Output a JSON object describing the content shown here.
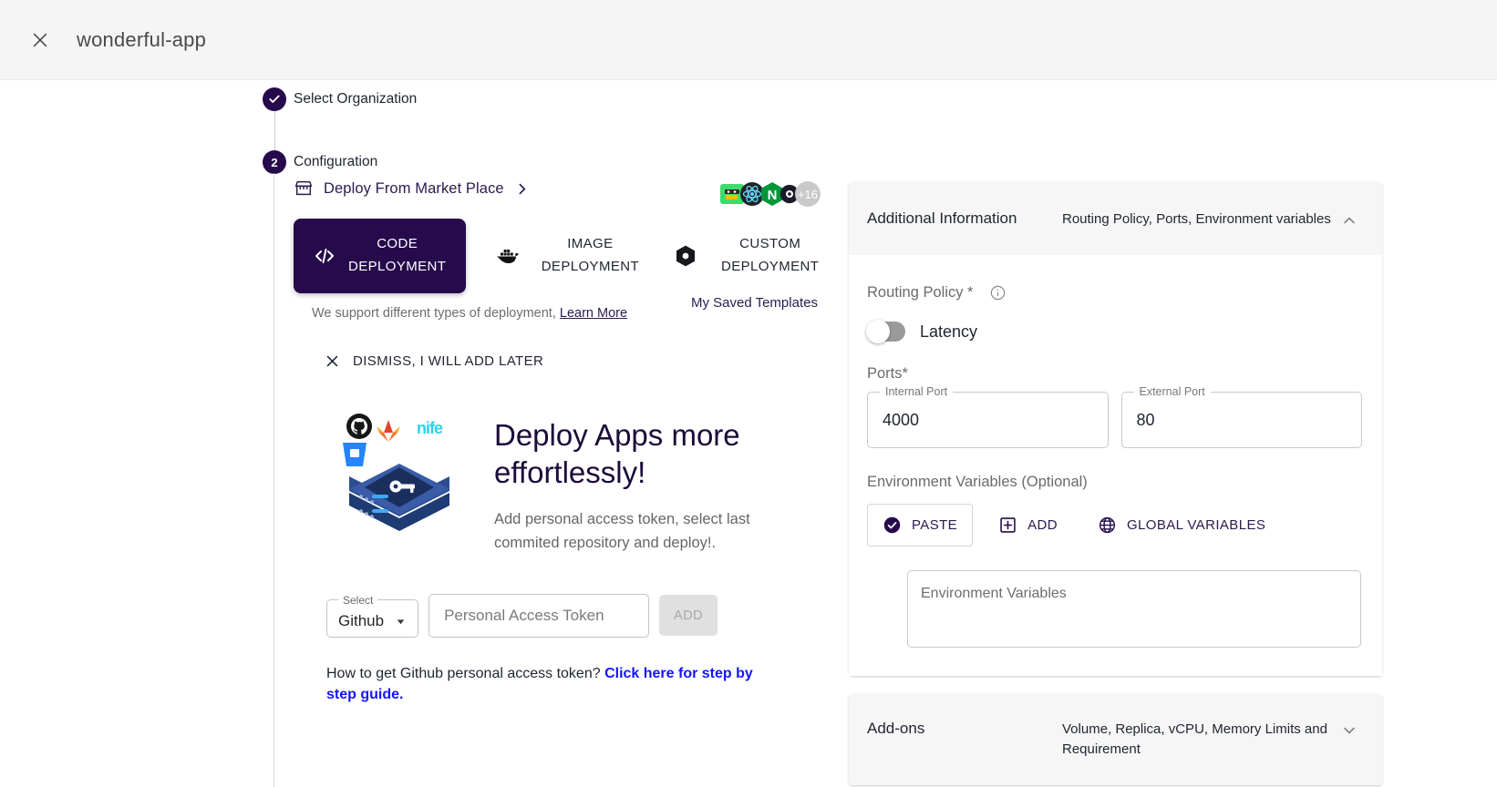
{
  "topbar": {
    "close_icon": "close-icon",
    "app_title": "wonderful-app"
  },
  "stepper": {
    "steps": [
      {
        "marker": "✓",
        "label": "Select Organization",
        "state": "completed"
      },
      {
        "marker": "2",
        "label": "Configuration",
        "state": "active"
      }
    ]
  },
  "marketplace": {
    "icon": "storefront-icon",
    "label": "Deploy From Market Place",
    "chevron": "chevron-right-icon",
    "tech_icons": [
      "mongodb-icon",
      "react-icon",
      "nginx-icon",
      "other-icon",
      "plus-16-icon"
    ]
  },
  "deployment_tabs": [
    {
      "id": "code",
      "icon": "code-brackets-icon",
      "line1": "CODE",
      "line2": "DEPLOYMENT",
      "active": true
    },
    {
      "id": "image",
      "icon": "docker-whale-icon",
      "line1": "IMAGE",
      "line2": "DEPLOYMENT",
      "active": false
    },
    {
      "id": "custom",
      "icon": "hexagon-gear-icon",
      "line1": "CUSTOM",
      "line2": "DEPLOYMENT",
      "active": false
    }
  ],
  "support": {
    "text": "We support different types of deployment,",
    "link": "Learn More"
  },
  "saved_templates_label": "My Saved Templates",
  "dismiss": {
    "icon": "close-icon",
    "label": "DISMISS, I WILL ADD LATER"
  },
  "hero": {
    "art_name": "server-key-illustration",
    "art_badges": [
      "github-icon",
      "gitlab-icon",
      "bitbucket-icon",
      "nife-logo"
    ],
    "heading": "Deploy Apps more effortlessly!",
    "paragraph": "Add personal access token, select last commited repository and deploy!."
  },
  "token_form": {
    "select_legend": "Select",
    "select_value": "Github",
    "select_caret": "caret-down-icon",
    "token_placeholder": "Personal Access Token",
    "token_value": "",
    "add_label": "ADD"
  },
  "howto": {
    "question": "How to get Github personal access token? ",
    "link": "Click here for step by step guide."
  },
  "additional_information": {
    "title": "Additional Information",
    "subtitle": "Routing Policy, Ports, Environment variables",
    "chevron": "chevron-up-icon",
    "routing_policy": {
      "label": "Routing Policy *",
      "info_icon": "info-circle-icon",
      "toggle_label": "Latency",
      "toggle_on": false
    },
    "ports": {
      "label": "Ports*",
      "internal": {
        "label": "Internal Port",
        "value": "4000"
      },
      "external": {
        "label": "External Port",
        "value": "80"
      }
    },
    "environment": {
      "label": "Environment Variables (Optional)",
      "actions": [
        {
          "id": "paste",
          "icon": "check-circle-icon",
          "label": "PASTE",
          "selected": true
        },
        {
          "id": "add",
          "icon": "plus-square-icon",
          "label": "ADD",
          "selected": false
        },
        {
          "id": "global",
          "icon": "globe-icon",
          "label": "GLOBAL VARIABLES",
          "selected": false
        }
      ],
      "textarea_placeholder": "Environment Variables",
      "textarea_value": ""
    }
  },
  "addons": {
    "title": "Add-ons",
    "subtitle": "Volume, Replica, vCPU, Memory Limits and Requirement",
    "chevron": "chevron-down-icon"
  },
  "colors": {
    "primary": "#260a4b",
    "link": "#1414ff",
    "header_bg": "#f5f5f5"
  }
}
